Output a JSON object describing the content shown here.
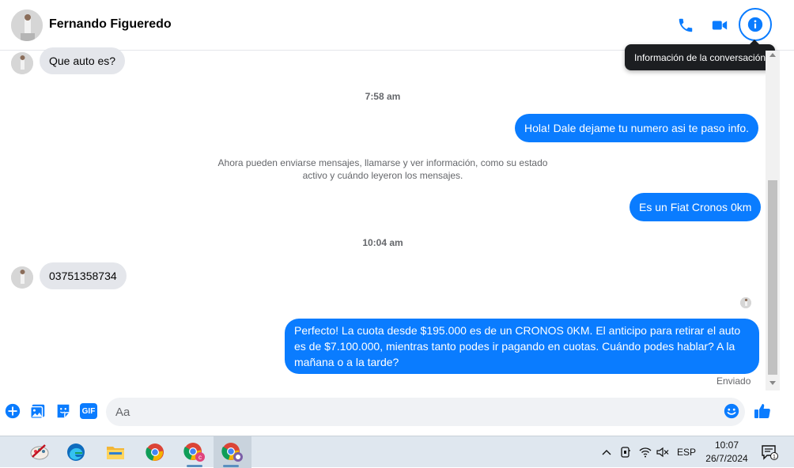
{
  "header": {
    "contact_name": "Fernando Figueredo",
    "tooltip": "Información de la conversación",
    "icons": [
      "phone-icon",
      "video-icon",
      "info-icon"
    ]
  },
  "messages": {
    "m1": "Que auto es?",
    "time1": "7:58 am",
    "m2": "Hola! Dale dejame tu numero  asi te paso info.",
    "system": "Ahora pueden enviarse mensajes, llamarse y ver información, como su estado activo y cuándo leyeron los mensajes.",
    "m3": "Es un Fiat Cronos 0km",
    "time2": "10:04 am",
    "m4": "03751358734",
    "m5": "Perfecto! La cuota desde $195.000 es de un CRONOS 0KM. El anticipo para retirar el auto es de $7.100.000, mientras tanto podes ir pagando en cuotas. Cuándo podes hablar? A la mañana o a la tarde?",
    "status": "Enviado"
  },
  "composer": {
    "placeholder": "Aa",
    "gif_label": "GIF"
  },
  "taskbar": {
    "language": "ESP",
    "time": "10:07",
    "date": "26/7/2024",
    "notifications": "1"
  },
  "colors": {
    "accent": "#0a7cff",
    "incoming_bubble": "#e4e6eb"
  }
}
